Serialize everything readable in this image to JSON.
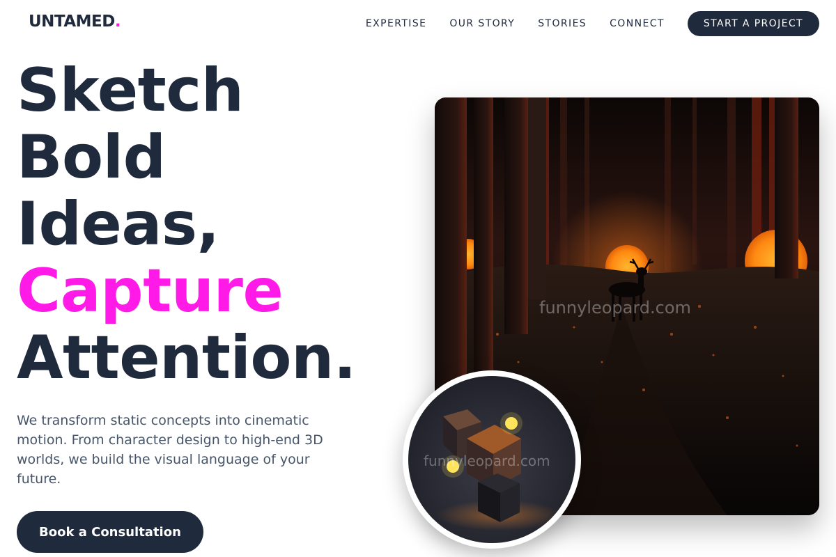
{
  "brand": {
    "name": "UNTAMED",
    "dot": "."
  },
  "nav": {
    "items": [
      "EXPERTISE",
      "OUR STORY",
      "STORIES",
      "CONNECT"
    ],
    "cta": "START A PROJECT"
  },
  "hero": {
    "lines": [
      "Sketch",
      "Bold",
      "Ideas,",
      "Capture",
      "Attention."
    ],
    "accent_color": "#ff1ae8",
    "lead": "We transform static concepts into cinematic motion. From character design to high-end 3D worlds, we build the visual language of your future.",
    "button": "Book a Consultation"
  },
  "images": {
    "main_watermark": "funnyleopard.com",
    "circle_watermark": "funnyleopard.com"
  },
  "colors": {
    "primary": "#1f2a3d",
    "accent": "#ff1ae8",
    "text_muted": "#475569"
  }
}
